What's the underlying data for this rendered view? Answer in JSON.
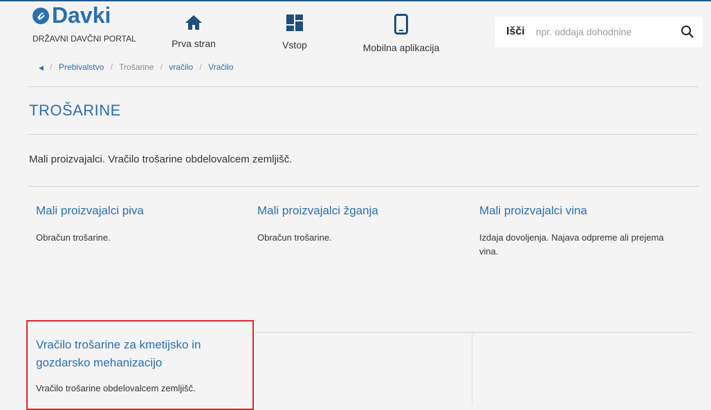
{
  "header": {
    "logo_text": "Davki",
    "logo_sub": "DRŽAVNI DAVČNI PORTAL",
    "nav": [
      {
        "label": "Prva stran",
        "icon": "home-icon"
      },
      {
        "label": "Vstop",
        "icon": "dashboard-icon"
      },
      {
        "label": "Mobilna aplikacija",
        "icon": "mobile-phone-icon"
      }
    ],
    "search": {
      "label": "Išči",
      "placeholder": "npr. oddaja dohodnine",
      "icon": "search-icon"
    }
  },
  "breadcrumb": {
    "back_icon": "chevron-left-icon",
    "items": [
      "Prebivalstvo",
      "Trošarine",
      "vračilo",
      "Vračilo"
    ]
  },
  "page": {
    "title": "TROŠARINE",
    "intro": "Mali proizvajalci. Vračilo trošarine obdelovalcem zemljišč."
  },
  "cards": [
    {
      "title": "Mali proizvajalci piva",
      "desc": "Obračun trošarine."
    },
    {
      "title": "Mali proizvajalci žganja",
      "desc": "Obračun trošarine."
    },
    {
      "title": "Mali proizvajalci vina",
      "desc": "Izdaja dovoljenja. Najava odpreme ali prejema vina."
    },
    {
      "title": "Vračilo trošarine za kmetijsko in gozdarsko mehanizacijo",
      "desc": "Vračilo trošarine obdelovalcem zemljišč."
    }
  ],
  "colors": {
    "brand": "#2b6fae",
    "highlight": "#d8262c"
  }
}
